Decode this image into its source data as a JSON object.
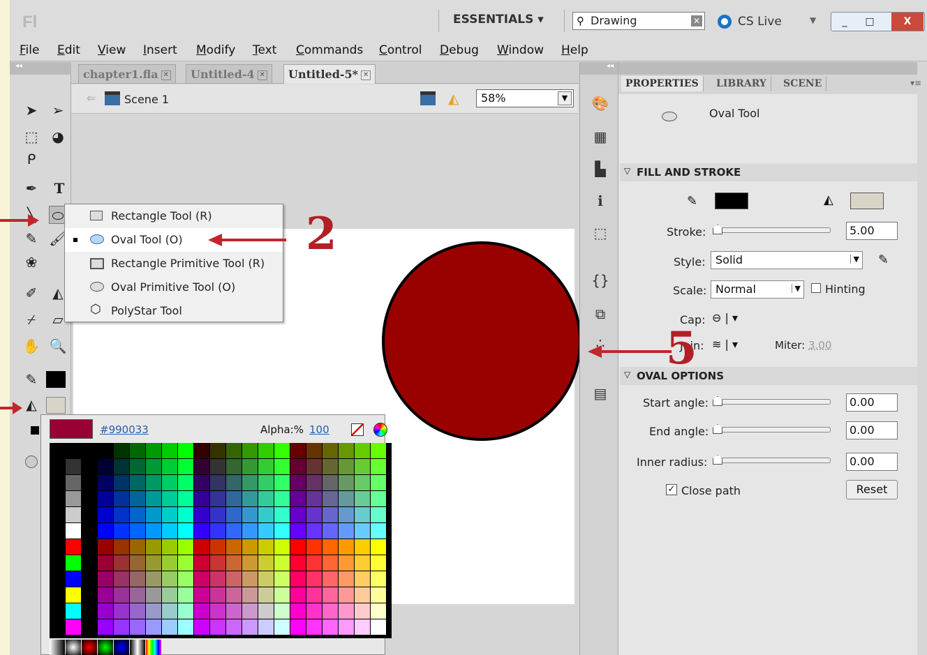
{
  "titlebar": {
    "logo": "Fl",
    "workspace": "ESSENTIALS ▾",
    "search_value": "Drawing",
    "cs_live": "CS Live",
    "minimize": "_",
    "maximize": "□",
    "close": "X"
  },
  "menu": [
    "File",
    "Edit",
    "View",
    "Insert",
    "Modify",
    "Text",
    "Commands",
    "Control",
    "Debug",
    "Window",
    "Help"
  ],
  "tabs": [
    {
      "label": "chapter1.fla"
    },
    {
      "label": "Untitled-4"
    },
    {
      "label": "Untitled-5*"
    }
  ],
  "stage": {
    "scene": "Scene 1",
    "zoom": "58%",
    "circle_fill": "#990000",
    "circle_stroke": "#000000"
  },
  "flyout": {
    "items": [
      {
        "label": "Rectangle Tool (R)"
      },
      {
        "label": "Oval Tool (O)"
      },
      {
        "label": "Rectangle Primitive Tool (R)"
      },
      {
        "label": "Oval Primitive Tool (O)"
      },
      {
        "label": "PolyStar Tool"
      }
    ],
    "selected": "Oval Tool (O)"
  },
  "swatches": {
    "hex": "#990033",
    "alpha_label": "Alpha:%",
    "alpha_value": "100",
    "preview_color": "#990033"
  },
  "panel": {
    "tabs": [
      "PROPERTIES",
      "LIBRARY",
      "SCENE"
    ],
    "tool_name": "Oval Tool",
    "fill_stroke": {
      "header": "FILL AND STROKE",
      "stroke_label": "Stroke:",
      "stroke_value": "5.00",
      "style_label": "Style:",
      "style_value": "Solid",
      "scale_label": "Scale:",
      "scale_value": "Normal",
      "hinting_label": "Hinting",
      "cap_label": "Cap:",
      "join_label": "Join:",
      "miter_label": "Miter:",
      "miter_value": "3.00",
      "stroke_color": "#000000",
      "fill_color": "#d8d4c8"
    },
    "oval_options": {
      "header": "OVAL OPTIONS",
      "start_label": "Start angle:",
      "start_value": "0.00",
      "end_label": "End angle:",
      "end_value": "0.00",
      "inner_label": "Inner radius:",
      "inner_value": "0.00",
      "close_path_label": "Close path",
      "reset_label": "Reset"
    }
  },
  "annotations": {
    "num_2": "2",
    "num_5": "5"
  }
}
